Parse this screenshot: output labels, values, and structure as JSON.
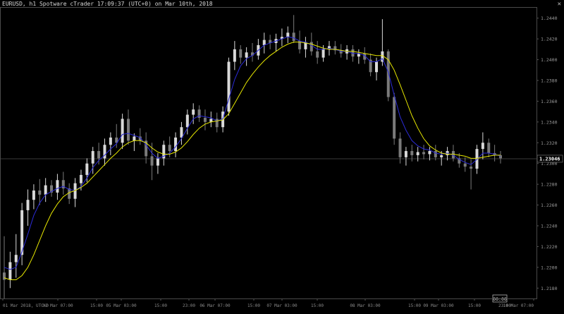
{
  "header": {
    "title": "EURUSD, h1 Spotware cTrader 17:09:37 (UTC+0) on Mar 10th, 2018",
    "close_glyph": "✕"
  },
  "chart_data": {
    "type": "candlestick",
    "symbol": "EURUSD",
    "timeframe": "h1",
    "ylim": [
      1.217,
      1.245
    ],
    "y_ticks": [
      "1.2440",
      "1.2420",
      "1.2400",
      "1.2380",
      "1.2360",
      "1.2340",
      "1.2320",
      "1.2300",
      "1.2280",
      "1.2260",
      "1.2240",
      "1.2220",
      "1.2200",
      "1.2180",
      "1.2160"
    ],
    "y_tick_values": [
      1.244,
      1.242,
      1.24,
      1.238,
      1.236,
      1.234,
      1.232,
      1.23,
      1.228,
      1.226,
      1.224,
      1.222,
      1.22,
      1.218,
      1.216
    ],
    "current_price_label": "1.23046",
    "current_price": 1.23046,
    "x_ticks": [
      "01 Mar 2018, UTC+0",
      "02 Mar 07:00",
      "15:00",
      "05 Mar 03:00",
      "15:00",
      "23:00",
      "06 Mar 07:00",
      "15:00",
      "07 Mar 03:00",
      "15:00",
      "08 Mar 03:00",
      "15:00",
      "09 Mar 03:00",
      "15:00",
      "23:00",
      "10 Mar 07:00"
    ],
    "crosshair_time_label": "00:00",
    "colors": {
      "bull": "#d9d9d9",
      "bear": "#7a7a7a",
      "ma_fast": "#2b2bd6",
      "ma_slow": "#e6e600",
      "grid": "#2a2a2a",
      "price_line": "#3a3a3a"
    },
    "ohlc": [
      [
        1.2195,
        1.223,
        1.217,
        1.2188
      ],
      [
        1.2188,
        1.2215,
        1.218,
        1.2205
      ],
      [
        1.2205,
        1.2232,
        1.219,
        1.2212
      ],
      [
        1.2212,
        1.2262,
        1.2202,
        1.2255
      ],
      [
        1.2255,
        1.2275,
        1.224,
        1.2265
      ],
      [
        1.2265,
        1.228,
        1.2256,
        1.2274
      ],
      [
        1.2274,
        1.2285,
        1.226,
        1.227
      ],
      [
        1.227,
        1.2286,
        1.2263,
        1.2279
      ],
      [
        1.2279,
        1.2284,
        1.2268,
        1.2272
      ],
      [
        1.2272,
        1.229,
        1.2265,
        1.2284
      ],
      [
        1.2284,
        1.2292,
        1.227,
        1.2276
      ],
      [
        1.2276,
        1.2281,
        1.2261,
        1.2266
      ],
      [
        1.2266,
        1.2286,
        1.2258,
        1.2281
      ],
      [
        1.2281,
        1.2294,
        1.2274,
        1.2289
      ],
      [
        1.2289,
        1.2305,
        1.2282,
        1.23
      ],
      [
        1.23,
        1.2316,
        1.229,
        1.2312
      ],
      [
        1.2312,
        1.232,
        1.2299,
        1.2305
      ],
      [
        1.2305,
        1.2324,
        1.2298,
        1.2318
      ],
      [
        1.2318,
        1.233,
        1.2308,
        1.2325
      ],
      [
        1.2325,
        1.2338,
        1.2315,
        1.232
      ],
      [
        1.232,
        1.2348,
        1.2314,
        1.2343
      ],
      [
        1.2343,
        1.2352,
        1.2318,
        1.2322
      ],
      [
        1.2322,
        1.2329,
        1.2312,
        1.2326
      ],
      [
        1.2326,
        1.2334,
        1.2318,
        1.2322
      ],
      [
        1.2322,
        1.233,
        1.23,
        1.2307
      ],
      [
        1.2307,
        1.232,
        1.2284,
        1.2298
      ],
      [
        1.2298,
        1.231,
        1.229,
        1.2305
      ],
      [
        1.2305,
        1.2322,
        1.2298,
        1.2318
      ],
      [
        1.2318,
        1.2326,
        1.2306,
        1.2312
      ],
      [
        1.2312,
        1.233,
        1.2306,
        1.2325
      ],
      [
        1.2325,
        1.234,
        1.2318,
        1.2335
      ],
      [
        1.2335,
        1.2352,
        1.2328,
        1.2347
      ],
      [
        1.2347,
        1.2358,
        1.2338,
        1.2352
      ],
      [
        1.2352,
        1.2356,
        1.234,
        1.2344
      ],
      [
        1.2344,
        1.2352,
        1.2332,
        1.234
      ],
      [
        1.234,
        1.235,
        1.2335,
        1.2343
      ],
      [
        1.2343,
        1.2349,
        1.233,
        1.2335
      ],
      [
        1.2335,
        1.2355,
        1.233,
        1.235
      ],
      [
        1.235,
        1.2402,
        1.2346,
        1.2398
      ],
      [
        1.2398,
        1.2418,
        1.239,
        1.241
      ],
      [
        1.241,
        1.2414,
        1.2396,
        1.2402
      ],
      [
        1.2402,
        1.2412,
        1.2394,
        1.2407
      ],
      [
        1.2407,
        1.2416,
        1.2398,
        1.2404
      ],
      [
        1.2404,
        1.242,
        1.24,
        1.2414
      ],
      [
        1.2414,
        1.2426,
        1.2406,
        1.2419
      ],
      [
        1.2419,
        1.2424,
        1.241,
        1.2416
      ],
      [
        1.2416,
        1.2425,
        1.2408,
        1.242
      ],
      [
        1.242,
        1.243,
        1.2413,
        1.2422
      ],
      [
        1.2422,
        1.2432,
        1.2416,
        1.2426
      ],
      [
        1.2426,
        1.2443,
        1.2416,
        1.2418
      ],
      [
        1.2418,
        1.2428,
        1.2406,
        1.241
      ],
      [
        1.241,
        1.2422,
        1.2402,
        1.2417
      ],
      [
        1.2417,
        1.2426,
        1.2404,
        1.2408
      ],
      [
        1.2408,
        1.2418,
        1.2396,
        1.2402
      ],
      [
        1.2402,
        1.2414,
        1.2398,
        1.241
      ],
      [
        1.241,
        1.2418,
        1.2404,
        1.2413
      ],
      [
        1.2413,
        1.2418,
        1.2405,
        1.2409
      ],
      [
        1.2409,
        1.2415,
        1.2402,
        1.2406
      ],
      [
        1.2406,
        1.2414,
        1.24,
        1.241
      ],
      [
        1.241,
        1.2414,
        1.2398,
        1.2403
      ],
      [
        1.2403,
        1.241,
        1.2396,
        1.2406
      ],
      [
        1.2406,
        1.2412,
        1.2396,
        1.24
      ],
      [
        1.24,
        1.2406,
        1.2384,
        1.2388
      ],
      [
        1.2388,
        1.2402,
        1.238,
        1.2398
      ],
      [
        1.2398,
        1.2439,
        1.2394,
        1.2408
      ],
      [
        1.2408,
        1.241,
        1.236,
        1.2364
      ],
      [
        1.2364,
        1.2368,
        1.2318,
        1.2324
      ],
      [
        1.2324,
        1.233,
        1.23,
        1.2306
      ],
      [
        1.2306,
        1.2316,
        1.2298,
        1.2312
      ],
      [
        1.2312,
        1.2318,
        1.2302,
        1.2308
      ],
      [
        1.2308,
        1.2316,
        1.2302,
        1.2311
      ],
      [
        1.2311,
        1.2318,
        1.2304,
        1.2309
      ],
      [
        1.2309,
        1.2316,
        1.2303,
        1.2312
      ],
      [
        1.2312,
        1.2318,
        1.2303,
        1.2306
      ],
      [
        1.2306,
        1.2312,
        1.2298,
        1.2308
      ],
      [
        1.2308,
        1.2316,
        1.2303,
        1.2312
      ],
      [
        1.2312,
        1.2318,
        1.2302,
        1.2305
      ],
      [
        1.2305,
        1.231,
        1.2296,
        1.23
      ],
      [
        1.23,
        1.2306,
        1.2292,
        1.2297
      ],
      [
        1.2297,
        1.2304,
        1.2275,
        1.2295
      ],
      [
        1.2295,
        1.2318,
        1.229,
        1.2314
      ],
      [
        1.2314,
        1.233,
        1.2304,
        1.232
      ],
      [
        1.232,
        1.2324,
        1.2306,
        1.231
      ],
      [
        1.231,
        1.2318,
        1.2302,
        1.2308
      ],
      [
        1.2308,
        1.2312,
        1.23,
        1.2305
      ]
    ],
    "ma_fast": [
      1.22,
      1.2198,
      1.22,
      1.2215,
      1.2232,
      1.225,
      1.2262,
      1.227,
      1.2273,
      1.2276,
      1.2278,
      1.2275,
      1.2274,
      1.2278,
      1.2286,
      1.2296,
      1.2303,
      1.2308,
      1.2314,
      1.2319,
      1.2328,
      1.2329,
      1.2327,
      1.2325,
      1.2318,
      1.231,
      1.2305,
      1.2307,
      1.231,
      1.2316,
      1.2324,
      1.2334,
      1.2343,
      1.2346,
      1.2345,
      1.2344,
      1.2341,
      1.2343,
      1.2362,
      1.2381,
      1.2394,
      1.2401,
      1.2404,
      1.2409,
      1.2414,
      1.2416,
      1.2418,
      1.242,
      1.2422,
      1.2421,
      1.2418,
      1.2417,
      1.2414,
      1.241,
      1.241,
      1.2411,
      1.241,
      1.2408,
      1.2408,
      1.2406,
      1.2406,
      1.2404,
      1.2398,
      1.2398,
      1.2401,
      1.2388,
      1.2366,
      1.2345,
      1.2332,
      1.2322,
      1.2317,
      1.2314,
      1.2313,
      1.231,
      1.2309,
      1.231,
      1.2308,
      1.2304,
      1.2301,
      1.2299,
      1.2304,
      1.231,
      1.231,
      1.2309,
      1.2307
    ],
    "ma_slow": [
      1.219,
      1.2188,
      1.2188,
      1.2192,
      1.22,
      1.2212,
      1.2226,
      1.224,
      1.2252,
      1.2261,
      1.2268,
      1.2272,
      1.2274,
      1.2277,
      1.2281,
      1.2287,
      1.2293,
      1.2299,
      1.2305,
      1.231,
      1.2316,
      1.232,
      1.2322,
      1.2322,
      1.232,
      1.2315,
      1.2311,
      1.2309,
      1.2309,
      1.2311,
      1.2315,
      1.2321,
      1.2328,
      1.2334,
      1.2338,
      1.234,
      1.2341,
      1.2342,
      1.2348,
      1.2358,
      1.2368,
      1.2378,
      1.2386,
      1.2393,
      1.2399,
      1.2404,
      1.2408,
      1.2412,
      1.2415,
      1.2417,
      1.2417,
      1.2416,
      1.2415,
      1.2413,
      1.2411,
      1.241,
      1.241,
      1.2409,
      1.2408,
      1.2408,
      1.2407,
      1.2406,
      1.2405,
      1.2404,
      1.2404,
      1.24,
      1.239,
      1.2376,
      1.2361,
      1.2346,
      1.2334,
      1.2324,
      1.2317,
      1.2313,
      1.231,
      1.2309,
      1.2309,
      1.2308,
      1.2307,
      1.2305,
      1.2305,
      1.2306,
      1.2307,
      1.2308,
      1.2308
    ]
  }
}
